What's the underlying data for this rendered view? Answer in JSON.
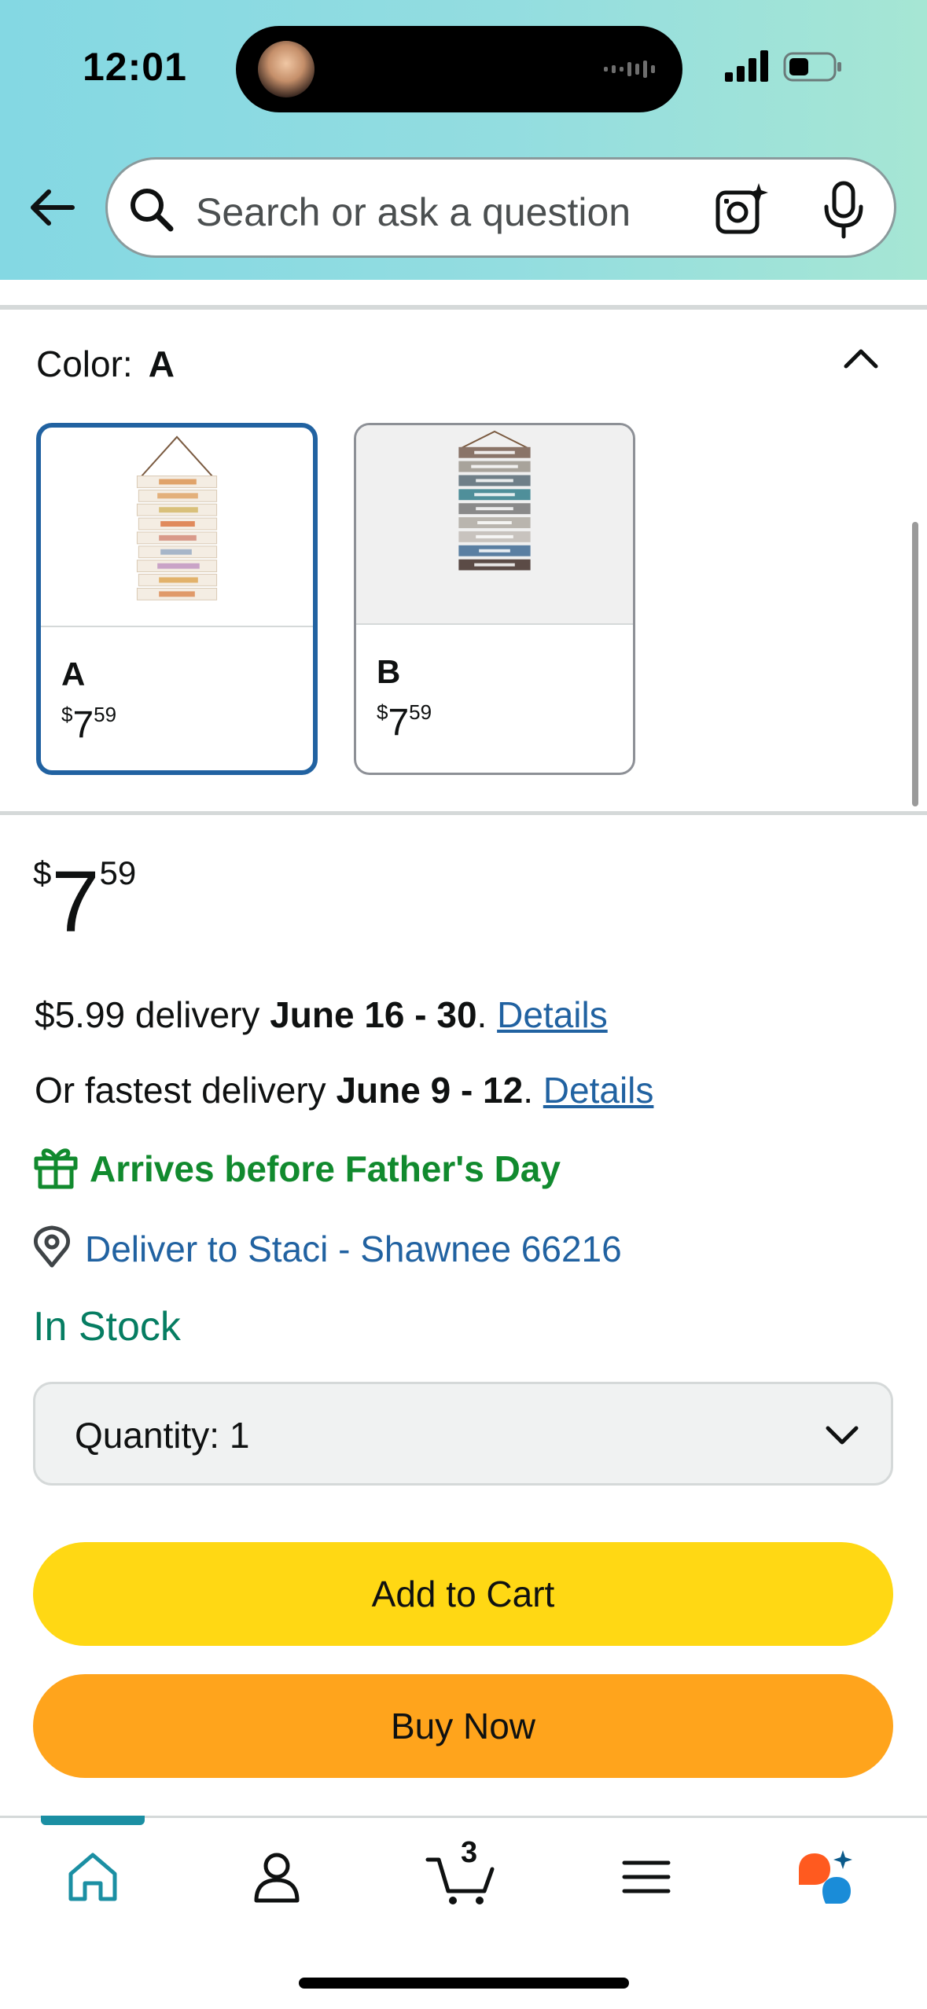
{
  "status_bar": {
    "time": "12:01"
  },
  "search": {
    "placeholder": "Search or ask a question"
  },
  "color_selector": {
    "label": "Color:",
    "selected": "A",
    "options": [
      {
        "name": "A",
        "price_symbol": "$",
        "price_whole": "7",
        "price_fraction": "59",
        "selected": true
      },
      {
        "name": "B",
        "price_symbol": "$",
        "price_whole": "7",
        "price_fraction": "59",
        "selected": false
      }
    ]
  },
  "price": {
    "symbol": "$",
    "whole": "7",
    "fraction": "59"
  },
  "delivery": {
    "standard_prefix": "$5.99 delivery ",
    "standard_dates": "June 16 - 30",
    "standard_suffix": ". ",
    "standard_link": "Details",
    "fast_prefix": "Or fastest delivery ",
    "fast_dates": "June 9 - 12",
    "fast_suffix": ". ",
    "fast_link": "Details"
  },
  "gift_notice": "Arrives before Father's Day",
  "deliver_to": "Deliver to Staci - Shawnee 66216",
  "stock_status": "In Stock",
  "quantity": {
    "label": "Quantity:",
    "value": "1"
  },
  "buttons": {
    "add_to_cart": "Add to Cart",
    "buy_now": "Buy Now"
  },
  "bottom_nav": {
    "items": [
      "home-icon",
      "account-icon",
      "cart-icon",
      "menu-icon",
      "rufus-icon"
    ],
    "cart_count": "3",
    "active": "home"
  },
  "colors": {
    "link": "#2162a1",
    "success": "#067d62",
    "add_to_cart": "#ffd814",
    "buy_now": "#ffa41c",
    "selected_border": "#2162a1",
    "active_nav": "#1b8fa3"
  }
}
